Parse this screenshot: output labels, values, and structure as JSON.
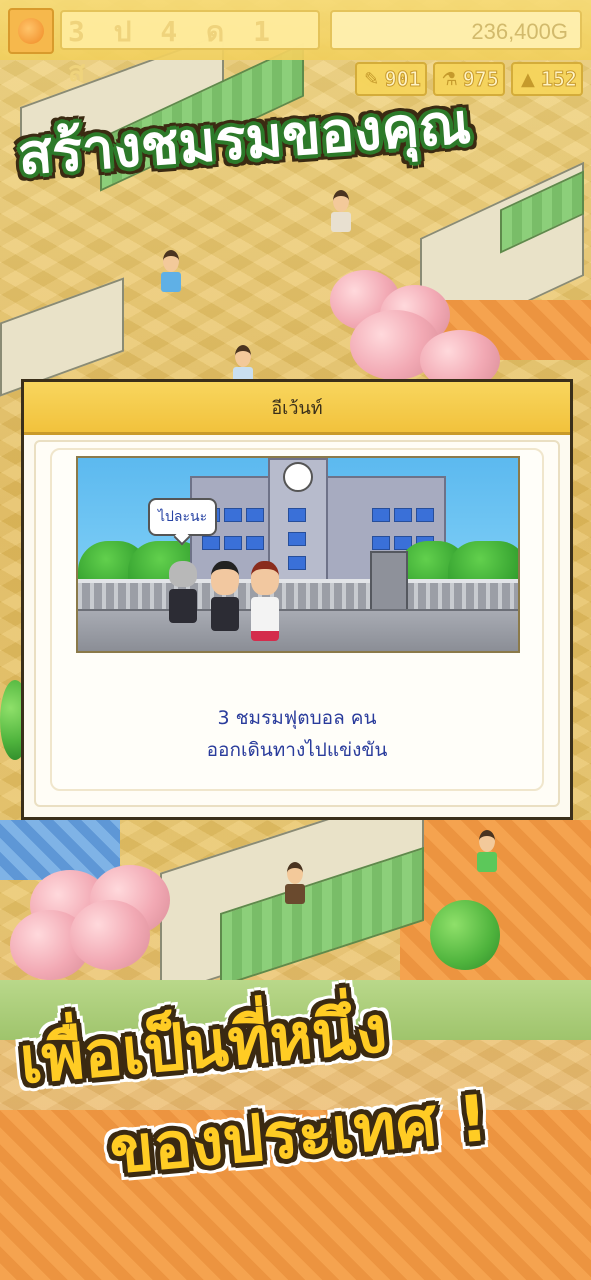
{
  "hud": {
    "date_label": "3 ป 4 ด 1 ส",
    "money": "236,400G",
    "stats": [
      {
        "icon": "pencil-icon",
        "value": "901"
      },
      {
        "icon": "flask-icon",
        "value": "975"
      },
      {
        "icon": "cone-icon",
        "value": "152"
      }
    ]
  },
  "headline": {
    "top": "สร้างชมรมของคุณ",
    "bottom_line1": "เพื่อเป็นที่หนึ่ง",
    "bottom_line2": "ของประเทศ !"
  },
  "dialog": {
    "title": "อีเว้นท์",
    "speech": "ไปละนะ",
    "message_line1": "3 ชมรมฟุตบอล คน",
    "message_line2": "ออกเดินทางไปแข่งขัน"
  },
  "colors": {
    "accent_yellow": "#ffcc24",
    "title_green": "#2d7a2a",
    "outline_brown": "#3b2a12",
    "message_blue": "#2a3c9c"
  }
}
